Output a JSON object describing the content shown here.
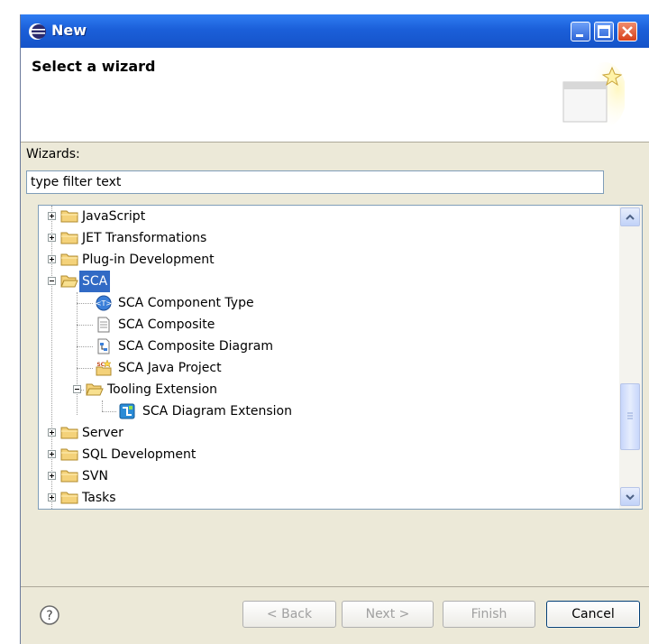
{
  "window": {
    "title": "New"
  },
  "header": {
    "title": "Select a wizard"
  },
  "wizards": {
    "label": "Wizards:",
    "filter_value": "type filter text"
  },
  "tree": {
    "items": [
      {
        "label": "JavaScript",
        "type": "folder",
        "expanded": false
      },
      {
        "label": "JET Transformations",
        "type": "folder",
        "expanded": false
      },
      {
        "label": "Plug-in Development",
        "type": "folder",
        "expanded": false
      },
      {
        "label": "SCA",
        "type": "folder",
        "expanded": true,
        "selected": true
      },
      {
        "label": "SCA Component Type",
        "type": "item",
        "icon": "sca-component-icon"
      },
      {
        "label": "SCA Composite",
        "type": "item",
        "icon": "document-icon"
      },
      {
        "label": "SCA Composite Diagram",
        "type": "item",
        "icon": "diagram-icon"
      },
      {
        "label": "SCA Java Project",
        "type": "item",
        "icon": "sca-java-project-icon"
      },
      {
        "label": "Tooling Extension",
        "type": "folder",
        "expanded": true
      },
      {
        "label": "SCA Diagram Extension",
        "type": "item",
        "icon": "sca-diagram-extension-icon"
      },
      {
        "label": "Server",
        "type": "folder",
        "expanded": false
      },
      {
        "label": "SQL Development",
        "type": "folder",
        "expanded": false
      },
      {
        "label": "SVN",
        "type": "folder",
        "expanded": false
      },
      {
        "label": "Tasks",
        "type": "folder",
        "expanded": false
      }
    ]
  },
  "buttons": {
    "back": "< Back",
    "next": "Next >",
    "finish": "Finish",
    "cancel": "Cancel"
  },
  "colors": {
    "titlebar": "#1b5fd9",
    "selection": "#316ac5",
    "folder": "#f4d27a"
  }
}
